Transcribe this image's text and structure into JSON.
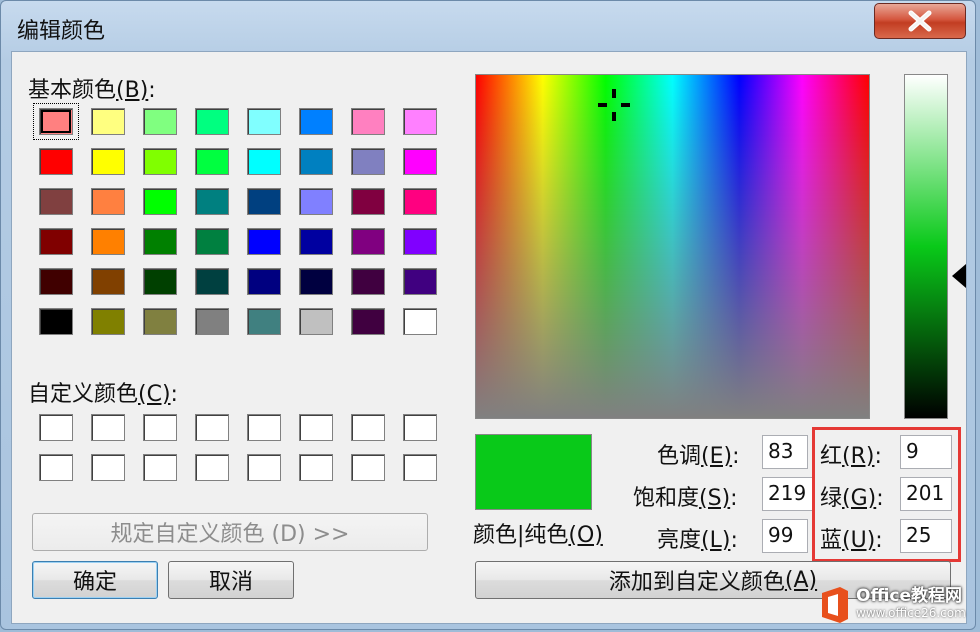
{
  "window": {
    "title": "编辑颜色"
  },
  "basic_colors": {
    "label": "基本颜色",
    "mnemonic": "(B)",
    "colon": ":",
    "selected_index": 0,
    "colors": [
      "#ff8080",
      "#ffff80",
      "#80ff80",
      "#00ff80",
      "#80ffff",
      "#0080ff",
      "#ff80c0",
      "#ff80ff",
      "#ff0000",
      "#ffff00",
      "#80ff00",
      "#00ff40",
      "#00ffff",
      "#0080c0",
      "#8080c0",
      "#ff00ff",
      "#804040",
      "#ff8040",
      "#00ff00",
      "#008080",
      "#004080",
      "#8080ff",
      "#800040",
      "#ff0080",
      "#800000",
      "#ff8000",
      "#008000",
      "#008040",
      "#0000ff",
      "#0000a0",
      "#800080",
      "#8000ff",
      "#400000",
      "#804000",
      "#004000",
      "#004040",
      "#000080",
      "#000040",
      "#400040",
      "#400080",
      "#000000",
      "#808000",
      "#808040",
      "#808080",
      "#408080",
      "#c0c0c0",
      "#400040",
      "#ffffff"
    ]
  },
  "custom_colors": {
    "label": "自定义颜色",
    "mnemonic": "(C)",
    "colon": ":",
    "colors": [
      "#ffffff",
      "#ffffff",
      "#ffffff",
      "#ffffff",
      "#ffffff",
      "#ffffff",
      "#ffffff",
      "#ffffff",
      "#ffffff",
      "#ffffff",
      "#ffffff",
      "#ffffff",
      "#ffffff",
      "#ffffff",
      "#ffffff",
      "#ffffff"
    ]
  },
  "buttons": {
    "define_custom": "规定自定义颜色 (D) >>",
    "ok": "确定",
    "cancel": "取消",
    "add_custom_prefix": "添加到自定义颜色",
    "add_custom_mnemonic": "(A)"
  },
  "color_solid": {
    "label_prefix": "颜色|纯色",
    "mnemonic": "(O)",
    "preview_color": "#09c919"
  },
  "hsl": {
    "hue_label": "色调",
    "hue_mnemonic": "(E)",
    "hue": "83",
    "sat_label": "饱和度",
    "sat_mnemonic": "(S)",
    "sat": "219",
    "lum_label": "亮度",
    "lum_mnemonic": "(L)",
    "lum": "99"
  },
  "rgb": {
    "red_label": "红",
    "red_mnemonic": "(R)",
    "red": "9",
    "green_label": "绿",
    "green_mnemonic": "(G)",
    "green": "201",
    "blue_label": "蓝",
    "blue_mnemonic": "(U)",
    "blue": "25"
  },
  "colon": ":",
  "highlight_color": "#e53935",
  "watermark": {
    "title": "Office教程网",
    "url": "www.office26.com",
    "brand_color": "#e8501c"
  }
}
